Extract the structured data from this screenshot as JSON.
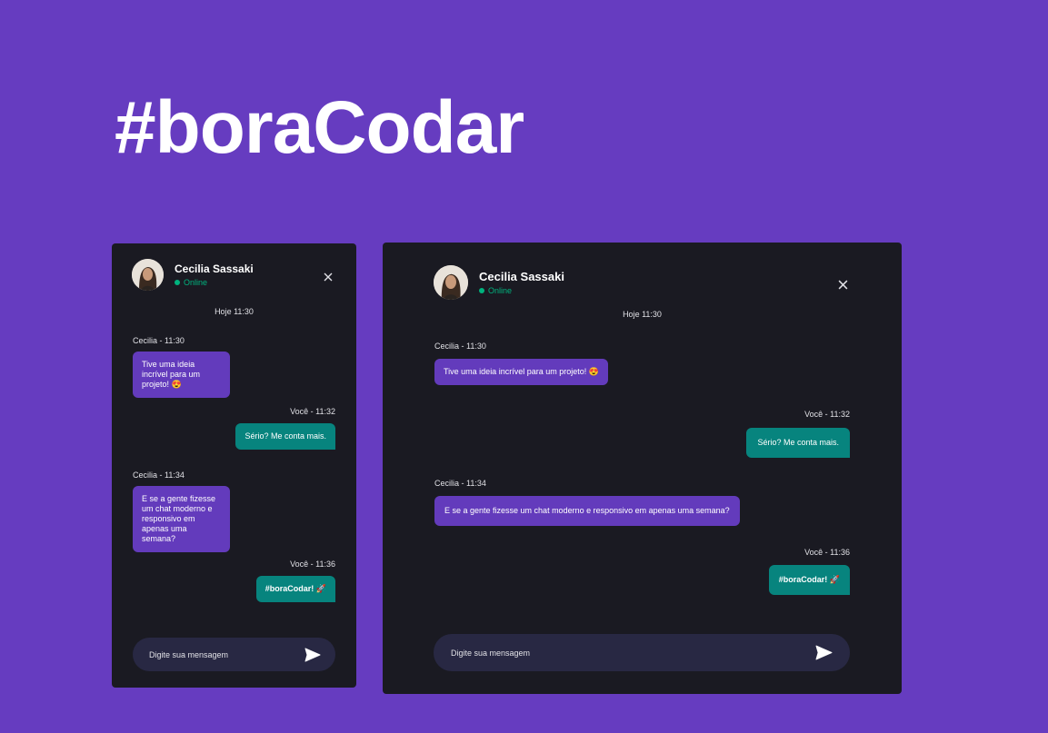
{
  "headline": "#boraCodar",
  "contact": {
    "name": "Cecilia Sassaki",
    "status": "Online"
  },
  "day_label": "Hoje 11:30",
  "messages": [
    {
      "author": "Cecilia - 11:30",
      "text": "Tive uma ideia incrível para um projeto! 😍"
    },
    {
      "author": "Você - 11:32",
      "text": "Sério? Me conta mais."
    },
    {
      "author": "Cecilia - 11:34",
      "text": "E se a gente fizesse um chat moderno e responsivo em apenas uma semana?"
    },
    {
      "author": "Você - 11:36",
      "text": "#boraCodar! 🚀"
    }
  ],
  "input": {
    "placeholder": "Digite sua mensagem"
  },
  "icons": {
    "close": "close-icon",
    "send": "send-icon",
    "status": "status-dot-icon"
  },
  "colors": {
    "background": "#663cc0",
    "panel": "#1a1a22",
    "incoming": "#633bbc",
    "outgoing": "#07847e",
    "online": "#00b37e",
    "input": "#282843"
  }
}
